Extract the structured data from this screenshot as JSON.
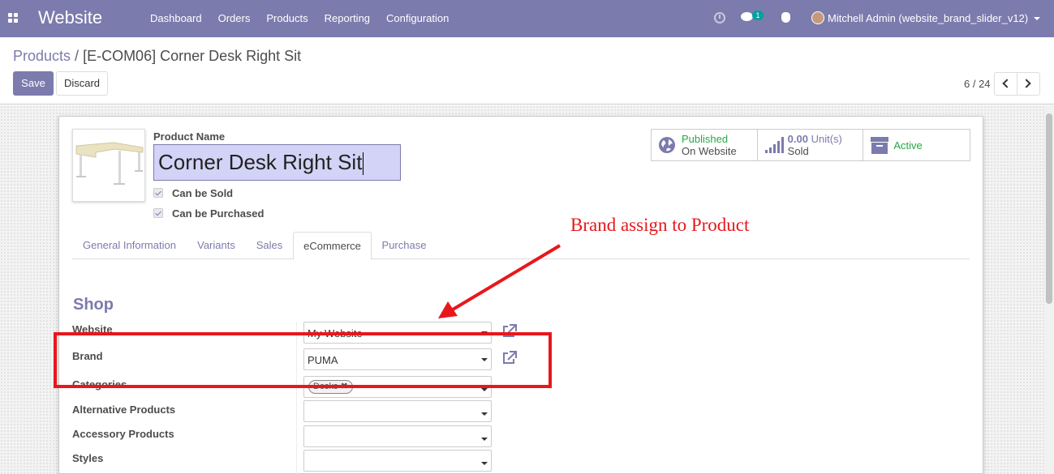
{
  "navbar": {
    "brand": "Website",
    "menu": [
      "Dashboard",
      "Orders",
      "Products",
      "Reporting",
      "Configuration"
    ],
    "chat_badge": "1",
    "user": "Mitchell Admin (website_brand_slider_v12)"
  },
  "breadcrumb": {
    "parent": "Products",
    "separator": "/",
    "current": "[E-COM06] Corner Desk Right Sit"
  },
  "actions": {
    "save": "Save",
    "discard": "Discard"
  },
  "pager": {
    "value": "6 / 24"
  },
  "product": {
    "name_label": "Product Name",
    "name": "Corner Desk Right Sit",
    "can_be_sold": "Can be Sold",
    "can_be_purchased": "Can be Purchased"
  },
  "stat_buttons": {
    "published_line1": "Published",
    "published_line2": "On Website",
    "sold_value": "0.00",
    "sold_unit": "Unit(s)",
    "sold_label": "Sold",
    "active": "Active"
  },
  "tabs": [
    "General Information",
    "Variants",
    "Sales",
    "eCommerce",
    "Purchase"
  ],
  "active_tab": "eCommerce",
  "shop": {
    "title": "Shop",
    "website_label": "Website",
    "website_value": "My Website",
    "brand_label": "Brand",
    "brand_value": "PUMA",
    "categories_label": "Categories",
    "categories_tag": "Desks",
    "alternative_label": "Alternative Products",
    "accessory_label": "Accessory Products",
    "styles_label": "Styles"
  },
  "annotation": {
    "text": "Brand assign to Product",
    "color": "#e8171c"
  },
  "colors": {
    "primary": "#7c7bad",
    "success": "#28a745"
  }
}
